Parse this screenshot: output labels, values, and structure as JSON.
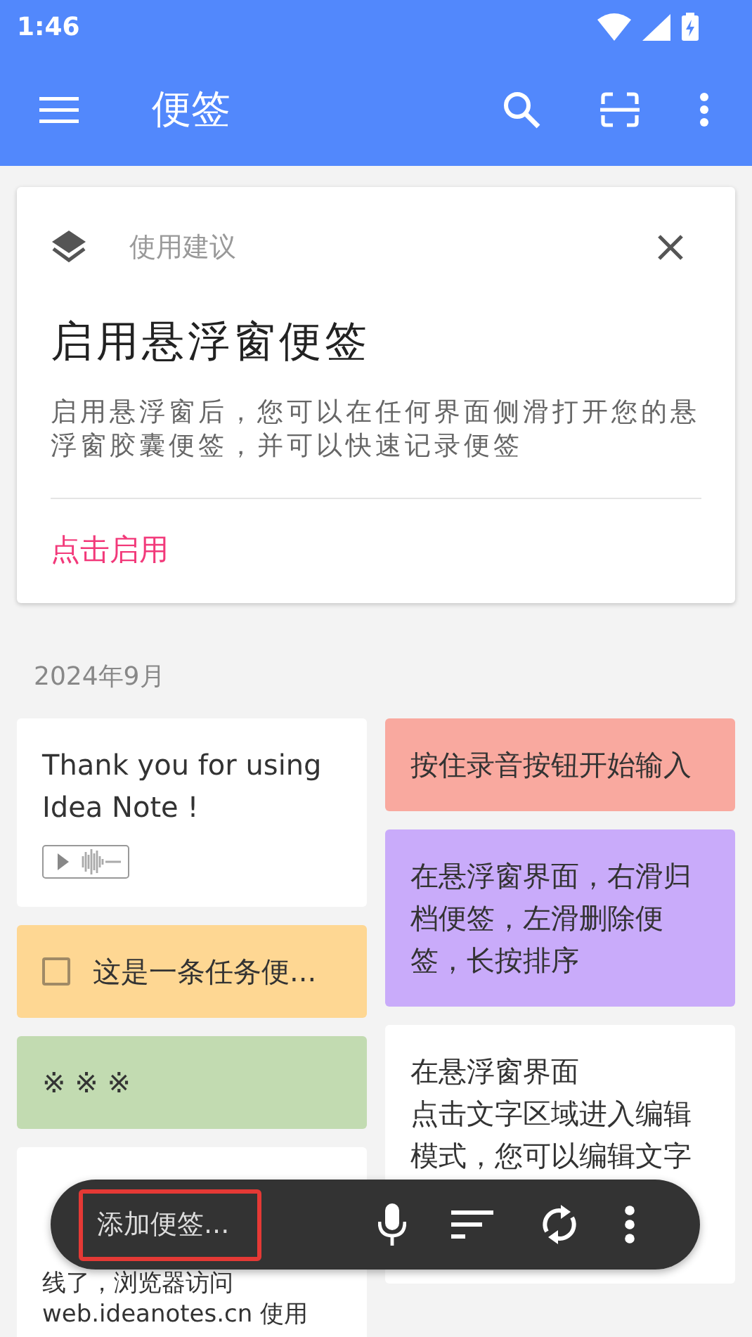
{
  "status_bar": {
    "time": "1:46"
  },
  "app_bar": {
    "title": "便签"
  },
  "tip_card": {
    "caption": "使用建议",
    "heading": "启用悬浮窗便签",
    "body": "启用悬浮窗后，您可以在任何界面侧滑打开您的悬浮窗胶囊便签，并可以快速记录便签",
    "action": "点击启用"
  },
  "section_date": "2024年9月",
  "notes_left": [
    {
      "kind": "audio",
      "color": "#ffffff",
      "text": "Thank you for using Idea Note !"
    },
    {
      "kind": "task",
      "color": "#fed793",
      "text": "这是一条任务便...",
      "checked": false
    },
    {
      "kind": "text",
      "color": "#c2dbb1",
      "text": "※ ※ ※"
    },
    {
      "kind": "lines",
      "color": "#ffffff",
      "lines": [
        "线了，浏览器访问",
        "web.ideanotes.cn 使用"
      ]
    }
  ],
  "notes_right": [
    {
      "kind": "text",
      "color": "#f9a99f",
      "text": "按住录音按钮开始输入"
    },
    {
      "kind": "text",
      "color": "#c9abfa",
      "text": "在悬浮窗界面，右滑归档便签，左滑删除便签，长按排序"
    },
    {
      "kind": "lines",
      "color": "#ffffff",
      "lines": [
        "在悬浮窗界面",
        "点击文字区域进入编辑",
        "模式，您可以编辑文字"
      ]
    }
  ],
  "quick_bar": {
    "placeholder": "添加便签..."
  }
}
